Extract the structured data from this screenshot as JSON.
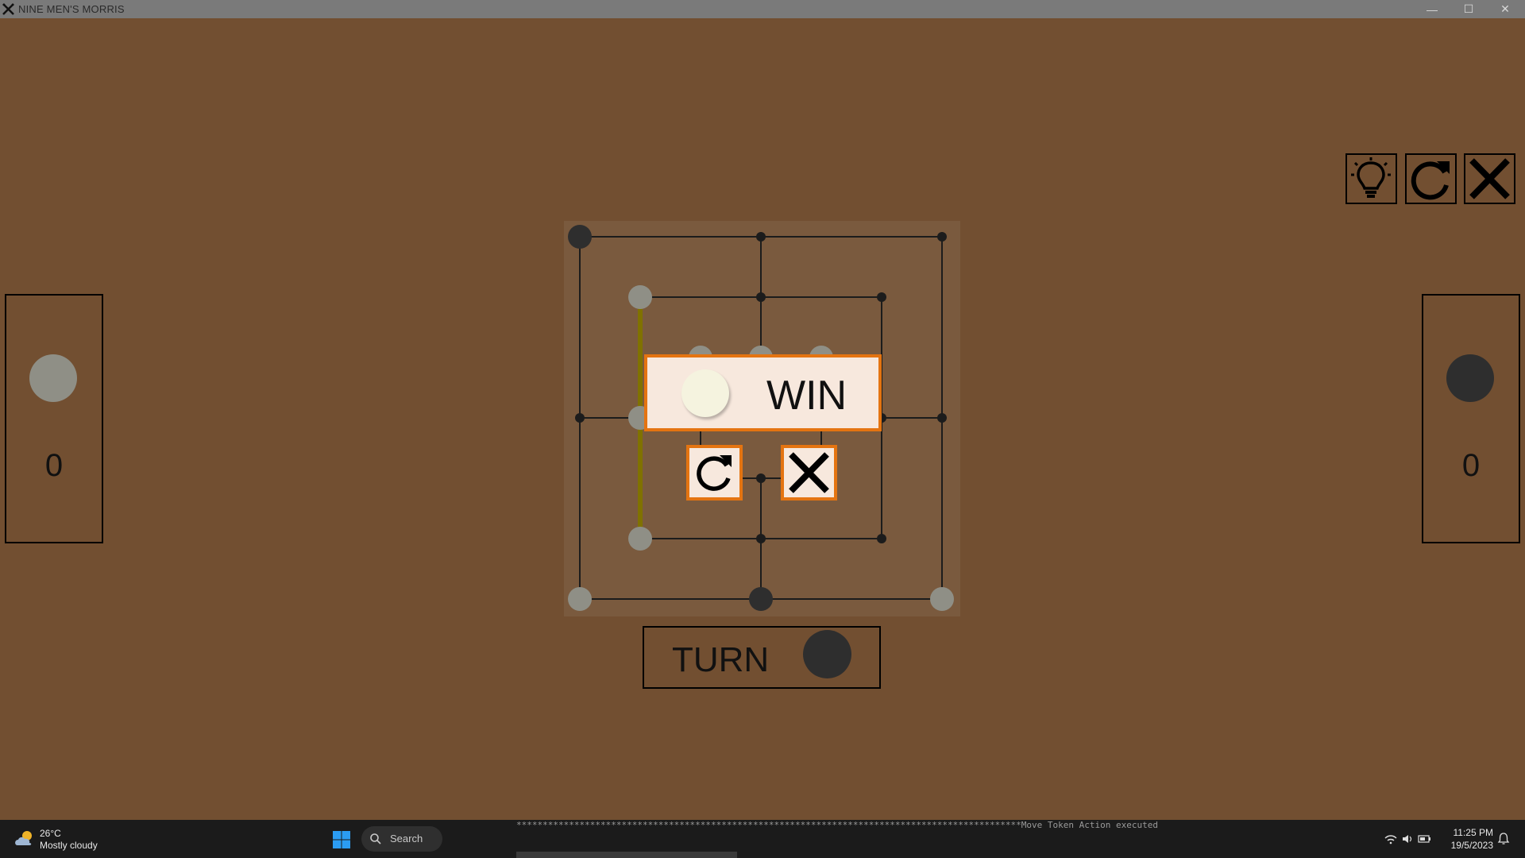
{
  "window": {
    "title": "NINE MEN'S MORRIS",
    "minimize_glyph": "—",
    "maximize_glyph": "☐",
    "close_glyph": "✕"
  },
  "toolbar": {
    "hint_icon": "lightbulb-icon",
    "restart_icon": "restart-icon",
    "close_icon": "close-icon"
  },
  "players": {
    "left": {
      "piece_color": "#8f8f86",
      "score": "0"
    },
    "right": {
      "piece_color": "#2e2e2e",
      "score": "0"
    }
  },
  "board": {
    "background": "#7a5a3e",
    "line_color": "#1c1c1c",
    "mill_highlight_color": "#807200"
  },
  "win_dialog": {
    "label": "WIN",
    "winner_piece_color": "#f5f3df",
    "border_color": "#e47411",
    "restart_icon": "restart-icon",
    "close_icon": "close-icon"
  },
  "turn": {
    "label": "TURN",
    "piece_color": "#2e2e2e"
  },
  "taskbar": {
    "weather_temp": "26°C",
    "weather_desc": "Mostly cloudy",
    "search_label": "Search",
    "console_text": "************************************************************************************************Move Token Action executed",
    "time": "11:25 PM",
    "date": "19/5/2023"
  }
}
